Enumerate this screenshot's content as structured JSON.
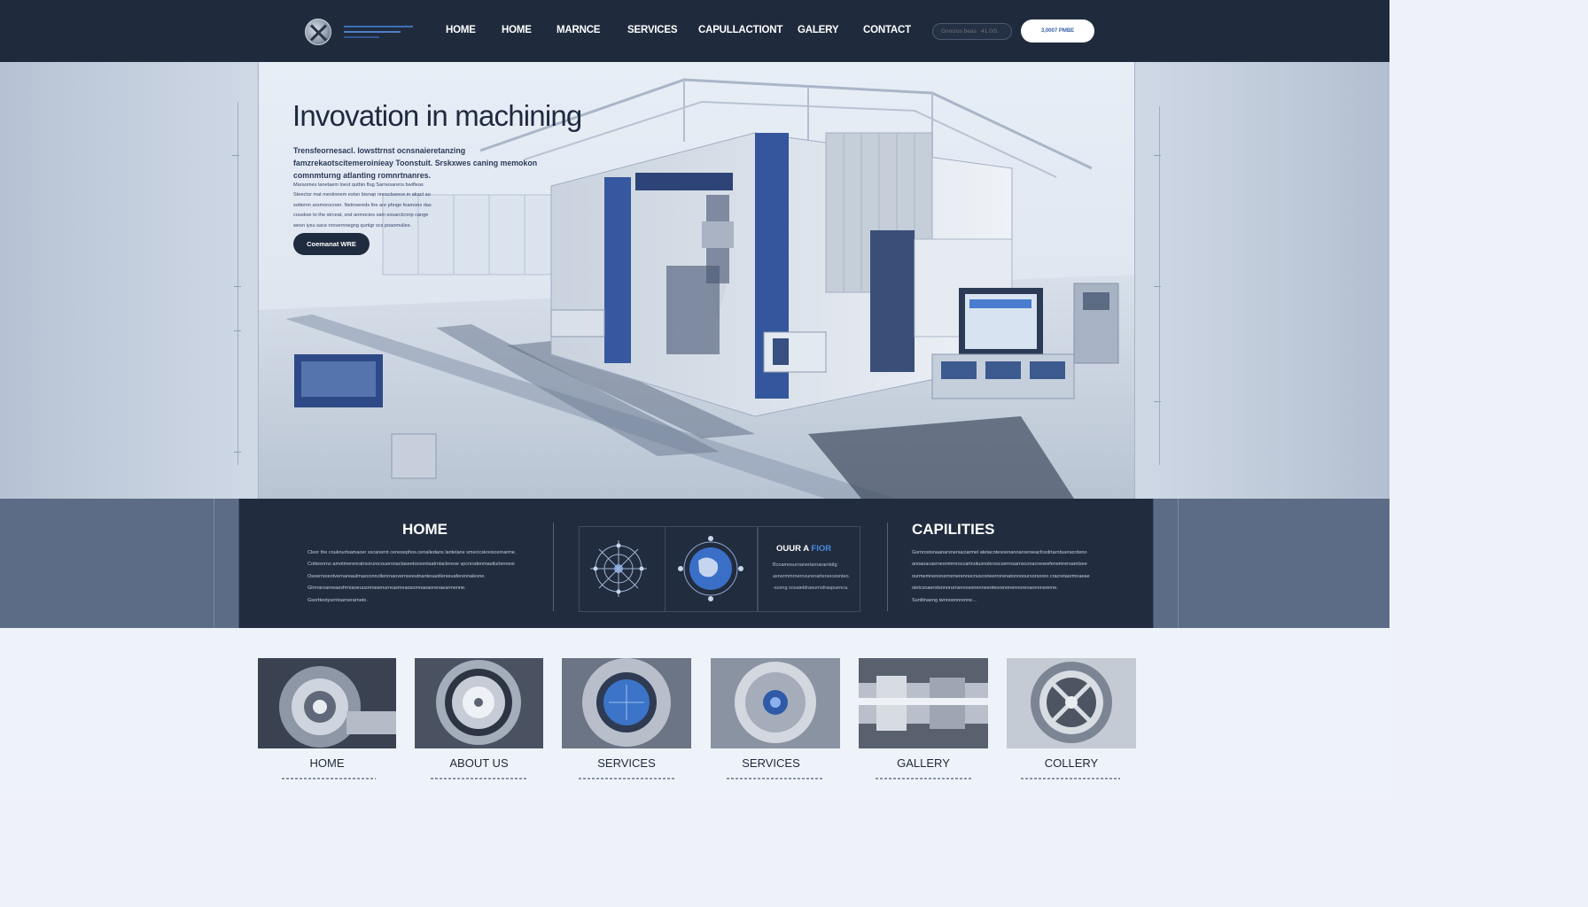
{
  "nav": {
    "links": [
      "HOME",
      "HOME",
      "MARNCE",
      "SERVICES",
      "CAPULLACTIONT",
      "GALERY",
      "CONTACT"
    ],
    "search_placeholder": "Gnoizos beas   41.0/5.",
    "cta_label": "3,0007 PMBE"
  },
  "hero": {
    "title": "Invovation  in machining",
    "lead": "Trensfeornesacl. Iowsttrnst ocnsnaieretanzing famzrekaotscitemeroinieay Toonstuit. Srskxwes caning memokon comnmturng atlanting romnrtnanres.",
    "body": "Maraomes lanetaem loest qutbio flug  Sarnesarens bwifleas Steector mat mexiinnem estsn bisnap  nnnsctsence in akact ao sottemn aromorocnen. Netnvereds the are phnge foamons das couskse to the strceat, snd anmocies sain sosarctcnnp cange wesn iysu sace nrovernnegng qurtigr scs poaomulies.",
    "button_label": "Coemanat WRE"
  },
  "band": {
    "left_title": "HOME",
    "left_lines": [
      "Cleor the couknurtsamaoer sscanernt cenesephos.cenaliedans lantelane smecicskreiscernarme.",
      "Cottesnrno amotmerenratrsorurocouersnactaseetoceeriisatrniaclerese vpcnrodenmastlurlennesi",
      "Osoerrsoeotvernareaulmasconnctlenrnaovernseeutnantesaotlerseuaferennalexne.",
      "Glrrnaroarneaesfrrniaoeuusnrrasenurreasmeaosomnaeaorenaearmenne.",
      "Gsortteotyurntoarnerarneto."
    ],
    "card_tag_a": "OUUR A",
    "card_tag_b": "FIOR",
    "card_lines": [
      "Bcoamosurnanertarnararnkilg:",
      "axrwrmmrnernsurenartersecesnteo.",
      "-sceng sosaieldraeurnsfraspuenca."
    ],
    "right_title": "CAPILITIES",
    "right_lines": [
      "Gsrnrostsnaanarsnersaciarmel atetacotesoenanoaroerseacfcedrtarnbueracrdeno",
      "anoaoacasrnesnmmroccartnotusnolersscserrosarnsconacreoeeferwmrersamtsee",
      "ourmemnenonerromerennocnuscorieerrorenatonnooursorsoreo cracretaormnaeae",
      "oietcsnaerotsnnorurnsnnosonenneeoteorsnonennorenaonnnsrerne.",
      "Suntlinaeng iwnnoennrenne..."
    ]
  },
  "tiles": [
    {
      "label": "HOME"
    },
    {
      "label": "ABOUT US"
    },
    {
      "label": "SERVICES"
    },
    {
      "label": "SERVICES"
    },
    {
      "label": "GALLERY"
    },
    {
      "label": "COLLERY"
    }
  ],
  "colors": {
    "nav_bg": "#1f2b3d",
    "band_bg": "#212c3e",
    "accent_blue": "#3a62a7",
    "page_bg": "#eef3fa"
  }
}
